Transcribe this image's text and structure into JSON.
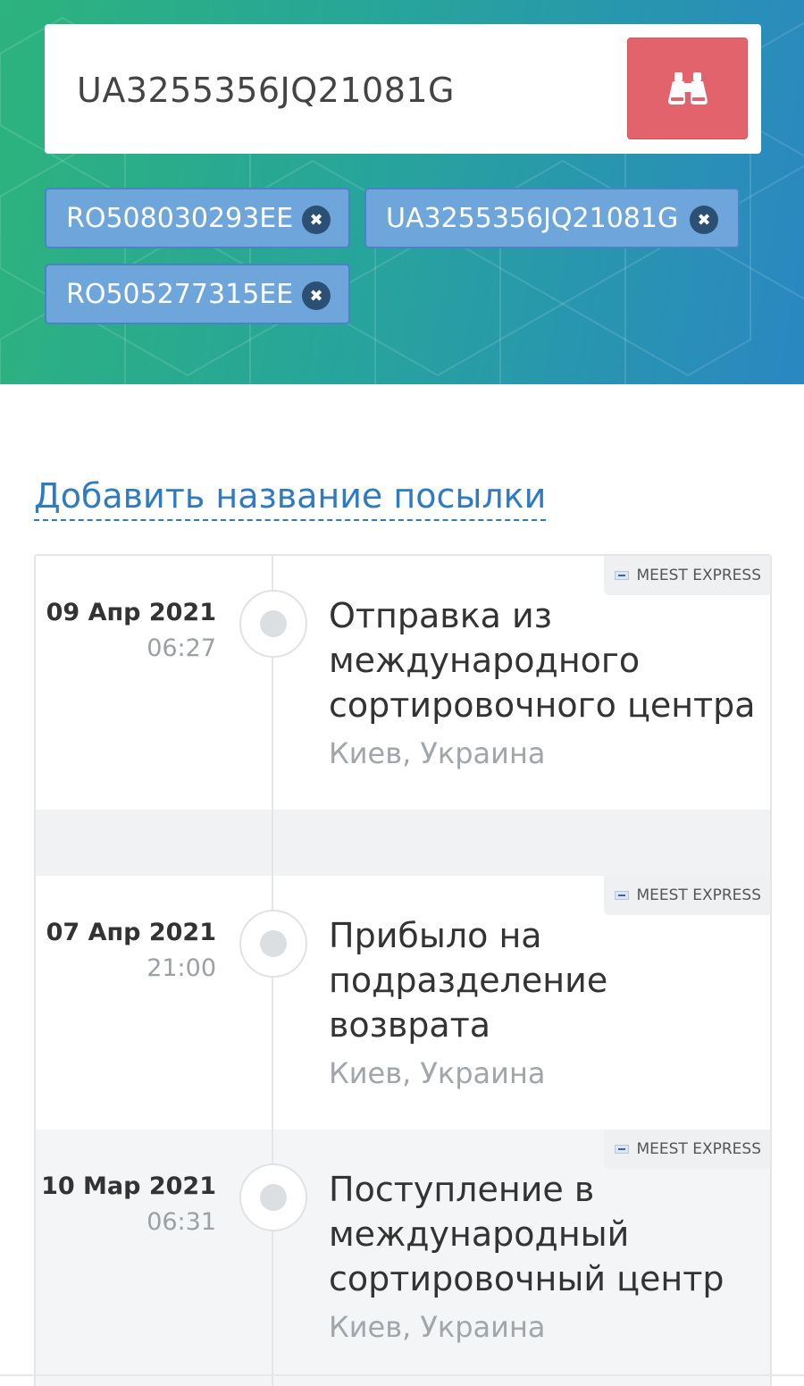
{
  "search": {
    "value": "UA3255356JQ21081G",
    "button_icon": "binoculars-icon"
  },
  "tracking_chips": [
    {
      "label": "RO508030293EE",
      "remove_icon": "close-icon"
    },
    {
      "label": "UA3255356JQ21081G",
      "remove_icon": "close-icon"
    },
    {
      "label": "RO505277315EE",
      "remove_icon": "close-icon"
    }
  ],
  "add_name_link": "Добавить название посылки",
  "events": [
    {
      "date": "09 Апр 2021",
      "time": "06:27",
      "status": "Отправка из международного сортировочного центра",
      "place": "Киев, Украина",
      "carrier": "MEEST EXPRESS"
    },
    {
      "date": "07 Апр 2021",
      "time": "21:00",
      "status": "Прибыло на подразделение возврата",
      "place": "Киев, Украина",
      "carrier": "MEEST EXPRESS"
    },
    {
      "date": "10 Мар 2021",
      "time": "06:31",
      "status": "Поступление в международный сортировочный центр",
      "place": "Киев, Украина",
      "carrier": "MEEST EXPRESS"
    }
  ],
  "colors": {
    "header_gradient_start": "#2db37d",
    "header_gradient_end": "#2a87c2",
    "search_button": "#e2636c",
    "chip": "#6ea6dc",
    "link": "#2f7bc3"
  }
}
